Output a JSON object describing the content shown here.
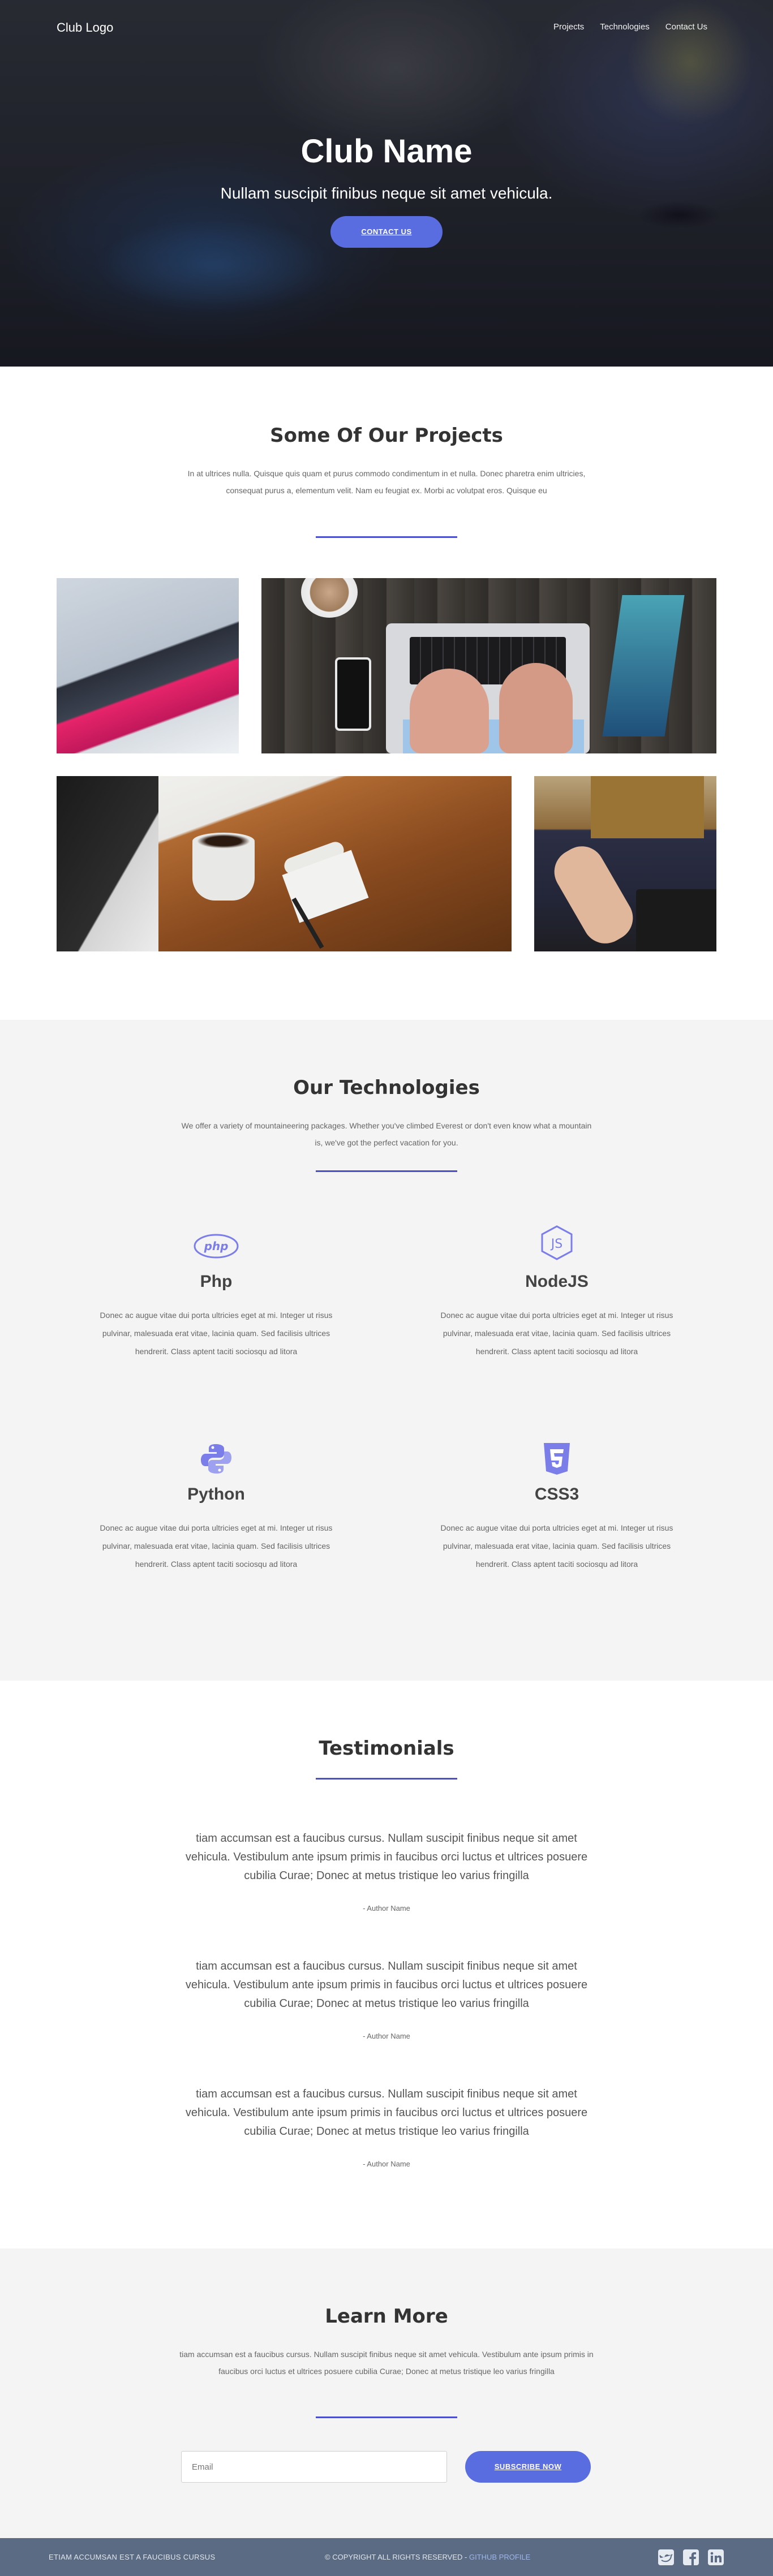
{
  "nav": {
    "logo": "Club Logo",
    "links": [
      "Projects",
      "Technologies",
      "Contact Us"
    ]
  },
  "hero": {
    "title": "Club Name",
    "subtitle": "Nullam suscipit finibus neque sit amet vehicula.",
    "cta": "Contact Us"
  },
  "projects": {
    "title": "Some Of Our Projects",
    "text": "In at ultrices nulla. Quisque quis quam et purus commodo condimentum in et nulla. Donec pharetra enim ultricies, consequat purus a, elementum velit. Nam eu feugiat ex. Morbi ac volutpat eros. Quisque eu"
  },
  "technologies": {
    "title": "Our Technologies",
    "text": "We offer a variety of mountaineering packages. Whether you've climbed Everest or don't even know what a mountain is, we've got the perfect vacation for you.",
    "items": [
      {
        "name": "Php",
        "icon": "php-icon",
        "desc": "Donec ac augue vitae dui porta ultricies eget at mi. Integer ut risus pulvinar, malesuada erat vitae, lacinia quam. Sed facilisis ultrices hendrerit. Class aptent taciti sociosqu ad litora"
      },
      {
        "name": "NodeJS",
        "icon": "nodejs-icon",
        "desc": "Donec ac augue vitae dui porta ultricies eget at mi. Integer ut risus pulvinar, malesuada erat vitae, lacinia quam. Sed facilisis ultrices hendrerit. Class aptent taciti sociosqu ad litora"
      },
      {
        "name": "Python",
        "icon": "python-icon",
        "desc": "Donec ac augue vitae dui porta ultricies eget at mi. Integer ut risus pulvinar, malesuada erat vitae, lacinia quam. Sed facilisis ultrices hendrerit. Class aptent taciti sociosqu ad litora"
      },
      {
        "name": "CSS3",
        "icon": "css3-icon",
        "desc": "Donec ac augue vitae dui porta ultricies eget at mi. Integer ut risus pulvinar, malesuada erat vitae, lacinia quam. Sed facilisis ultrices hendrerit. Class aptent taciti sociosqu ad litora"
      }
    ],
    "accent_color": "#7b7ee8"
  },
  "testimonials": {
    "title": "Testimonials",
    "items": [
      {
        "quote": "tiam accumsan est a faucibus cursus. Nullam suscipit finibus neque sit amet vehicula. Vestibulum ante ipsum primis in faucibus orci luctus et ultrices posuere cubilia Curae; Donec at metus tristique leo varius fringilla",
        "author": "- Author Name"
      },
      {
        "quote": "tiam accumsan est a faucibus cursus. Nullam suscipit finibus neque sit amet vehicula. Vestibulum ante ipsum primis in faucibus orci luctus et ultrices posuere cubilia Curae; Donec at metus tristique leo varius fringilla",
        "author": "- Author Name"
      },
      {
        "quote": "tiam accumsan est a faucibus cursus. Nullam suscipit finibus neque sit amet vehicula. Vestibulum ante ipsum primis in faucibus orci luctus et ultrices posuere cubilia Curae; Donec at metus tristique leo varius fringilla",
        "author": "- Author Name"
      }
    ]
  },
  "learn": {
    "title": "Learn More",
    "text": "tiam accumsan est a faucibus cursus. Nullam suscipit finibus neque sit amet vehicula. Vestibulum ante ipsum primis in faucibus orci luctus et ultrices posuere cubilia Curae; Donec at metus tristique leo varius fringilla",
    "email_placeholder": "Email",
    "subscribe": "Subscribe Now"
  },
  "footer": {
    "left": "Etiam accumsan est a faucibus cursus",
    "copyright": "© Copyright All Rights Reserved",
    "separator": " - ",
    "github": "Github Profile",
    "icons": [
      "twitter-icon",
      "facebook-icon",
      "linkedin-icon"
    ]
  },
  "colors": {
    "accent": "#5a6de0",
    "underline": "#4b4fc8",
    "footer": "#5b6b83"
  }
}
